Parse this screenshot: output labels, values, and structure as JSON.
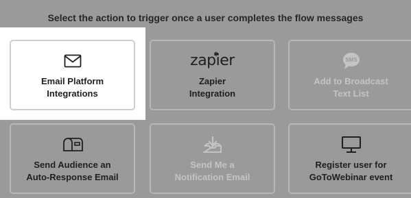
{
  "heading": "Select the action to trigger once a user completes the flow messages",
  "cards": [
    {
      "label": "Email Platform\nIntegrations",
      "icon": "envelope-icon",
      "state": "selected"
    },
    {
      "label": "Zapier\nIntegration",
      "icon": "zapier-logo",
      "logo_text": "zapier",
      "state": "enabled"
    },
    {
      "label": "Add to Broadcast\nText List",
      "icon": "sms-bubble-icon",
      "icon_text": "SMS",
      "state": "disabled"
    },
    {
      "label": "Send Audience an\nAuto-Response Email",
      "icon": "mailbox-icon",
      "state": "enabled"
    },
    {
      "label": "Send Me a\nNotification Email",
      "icon": "inbox-download-icon",
      "state": "disabled"
    },
    {
      "label": "Register user for\nGoToWebinar event",
      "icon": "monitor-icon",
      "state": "enabled"
    }
  ],
  "colors": {
    "background": "#9a9a9a",
    "card_border": "#b7b7b7",
    "disabled_text": "#c4c4c4",
    "text": "#1f1f1f"
  }
}
